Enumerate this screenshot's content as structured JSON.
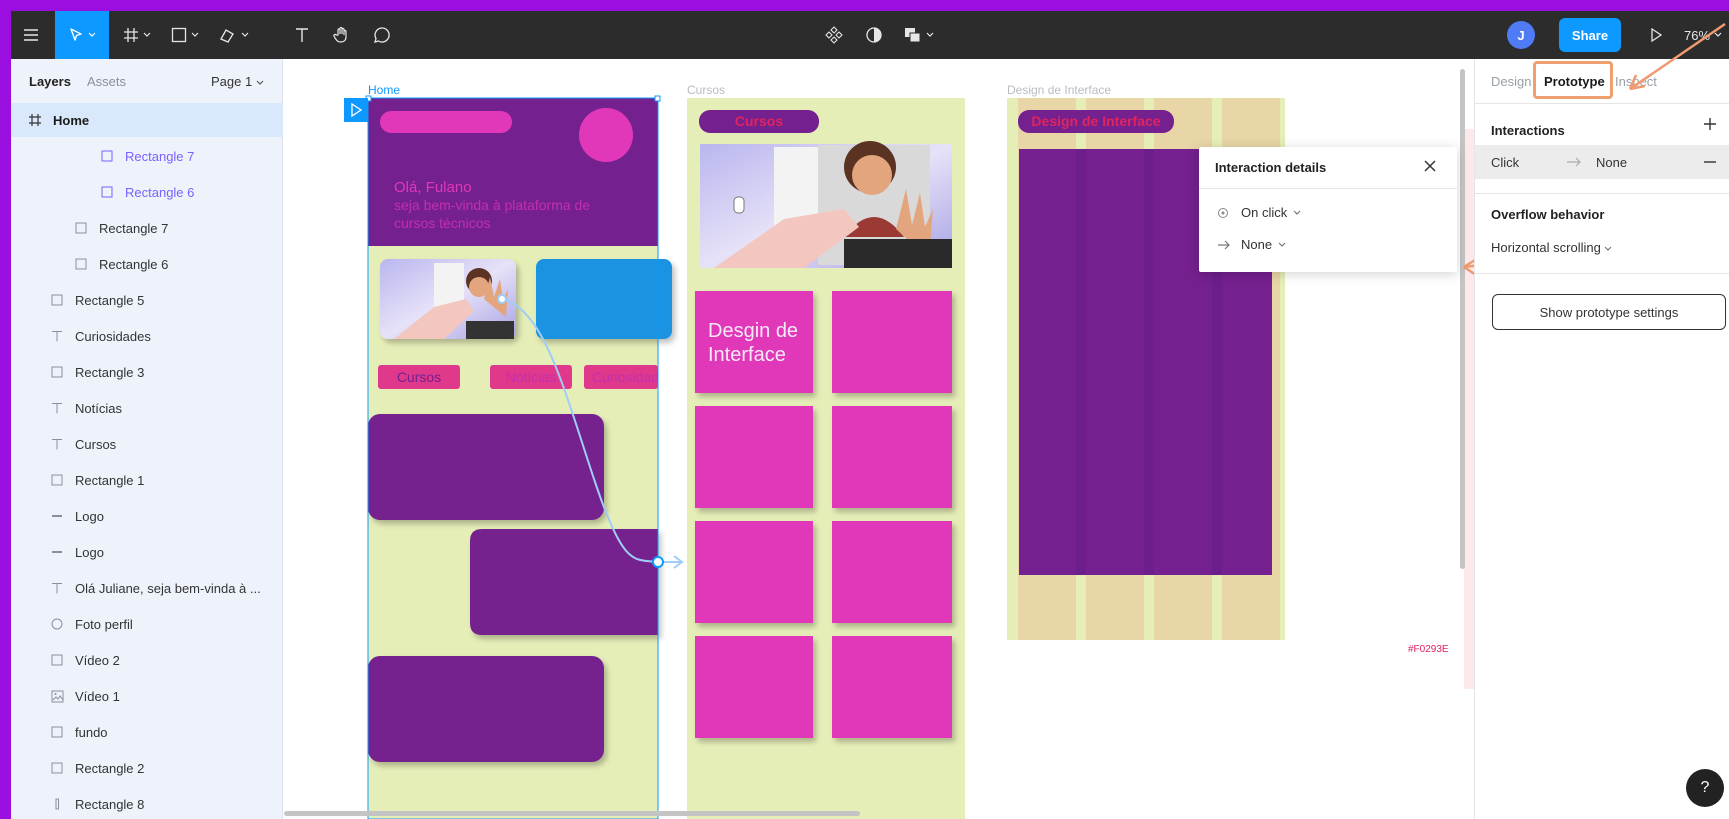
{
  "toolbar": {
    "zoom": "76%",
    "share_label": "Share",
    "avatar_initial": "J"
  },
  "layers_panel": {
    "tab_layers": "Layers",
    "tab_assets": "Assets",
    "page_selector": "Page 1",
    "items": [
      {
        "label": "Home",
        "icon": "frame-icon"
      },
      {
        "label": "Rectangle 7",
        "icon": "rectangle-icon"
      },
      {
        "label": "Rectangle 6",
        "icon": "rectangle-icon"
      },
      {
        "label": "Rectangle 7",
        "icon": "rectangle-icon"
      },
      {
        "label": "Rectangle 6",
        "icon": "rectangle-icon"
      },
      {
        "label": "Rectangle 5",
        "icon": "rectangle-icon"
      },
      {
        "label": "Curiosidades",
        "icon": "text-icon"
      },
      {
        "label": "Rectangle 3",
        "icon": "rectangle-icon"
      },
      {
        "label": "Notícias",
        "icon": "text-icon"
      },
      {
        "label": "Cursos",
        "icon": "text-icon"
      },
      {
        "label": "Rectangle 1",
        "icon": "rectangle-icon"
      },
      {
        "label": "Logo",
        "icon": "line-icon"
      },
      {
        "label": "Logo",
        "icon": "line-icon"
      },
      {
        "label": "Olá Juliane, seja bem-vinda à ...",
        "icon": "text-icon"
      },
      {
        "label": "Foto perfil",
        "icon": "ellipse-icon"
      },
      {
        "label": "Vídeo 2",
        "icon": "rectangle-icon"
      },
      {
        "label": "Vídeo 1",
        "icon": "image-icon"
      },
      {
        "label": "fundo",
        "icon": "rectangle-icon"
      },
      {
        "label": "Rectangle 2",
        "icon": "rectangle-icon"
      },
      {
        "label": "Rectangle 8",
        "icon": "vertical-rectangle-icon"
      }
    ]
  },
  "canvas": {
    "frames": {
      "home": "Home",
      "cursos": "Cursos",
      "design": "Design de Interface"
    },
    "home": {
      "greeting": "Olá, Fulano",
      "subtitle_line1": "seja bem-vinda à plataforma de",
      "subtitle_line2": "cursos técnicos",
      "tab_cursos": "Cursos",
      "tab_noticias": "Notícias",
      "tab_curiosidades": "Curiosidades"
    },
    "cursos": {
      "header": "Cursos",
      "card_title_line1": "Desgin de",
      "card_title_line2": "Interface"
    },
    "design": {
      "header": "Design de Interface"
    },
    "hex_label": "#F0293E",
    "colors": {
      "purple": "#74208e",
      "pink": "#e038b9",
      "green_bg": "#e6eeb8",
      "blue": "#1e93e0",
      "tan": "#e8d6a6"
    }
  },
  "right_panel": {
    "tab_design": "Design",
    "tab_prototype": "Prototype",
    "tab_inspect": "Inspect",
    "interactions_title": "Interactions",
    "interaction_trigger": "Click",
    "interaction_action": "None",
    "overflow_title": "Overflow behavior",
    "overflow_value": "Horizontal scrolling",
    "prototype_settings_button": "Show prototype settings"
  },
  "popover": {
    "title": "Interaction details",
    "trigger": "On click",
    "action": "None"
  },
  "help_label": "?"
}
